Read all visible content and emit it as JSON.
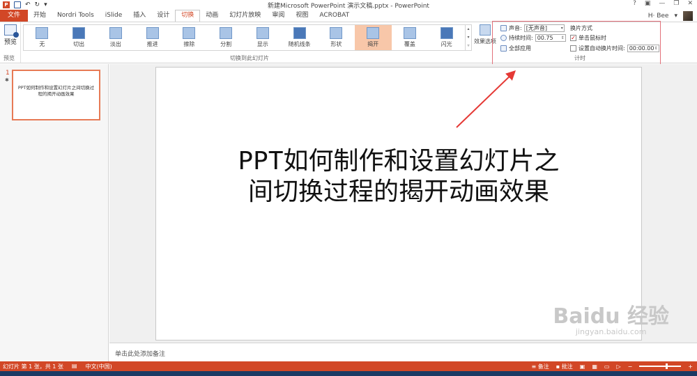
{
  "window": {
    "title": "新建Microsoft PowerPoint 演示文稿.pptx - PowerPoint",
    "controls": [
      "?",
      "▣",
      "—",
      "❐",
      "✕"
    ]
  },
  "tabs": [
    "文件",
    "开始",
    "Nordri Tools",
    "iSlide",
    "插入",
    "设计",
    "切换",
    "动画",
    "幻灯片放映",
    "审阅",
    "视图",
    "ACROBAT"
  ],
  "active_tab": "切换",
  "user": {
    "name": "H· Bee"
  },
  "ribbon": {
    "preview_label": "预览",
    "preview_group_label": "预览",
    "transition_group_label": "切换到此幻灯片",
    "effects": [
      {
        "label": "无",
        "icon": "none-transition-icon"
      },
      {
        "label": "切出",
        "icon": "cut-transition-icon"
      },
      {
        "label": "淡出",
        "icon": "fade-transition-icon"
      },
      {
        "label": "推进",
        "icon": "push-transition-icon"
      },
      {
        "label": "擦除",
        "icon": "wipe-transition-icon"
      },
      {
        "label": "分割",
        "icon": "split-transition-icon"
      },
      {
        "label": "显示",
        "icon": "reveal-transition-icon"
      },
      {
        "label": "随机线条",
        "icon": "random-bars-transition-icon"
      },
      {
        "label": "形状",
        "icon": "shape-transition-icon"
      },
      {
        "label": "揭开",
        "icon": "uncover-transition-icon"
      },
      {
        "label": "覆盖",
        "icon": "cover-transition-icon"
      },
      {
        "label": "闪光",
        "icon": "flash-transition-icon"
      }
    ],
    "selected_effect": "揭开",
    "effect_options_label": "效果选项",
    "timing": {
      "sound_label": "声音:",
      "sound_value": "[无声音]",
      "duration_label": "持续时间:",
      "duration_value": "00.75",
      "apply_all_label": "全部应用",
      "advance_label": "换片方式",
      "on_click_label": "单击鼠标时",
      "on_click_checked": true,
      "auto_label": "设置自动换片时间:",
      "auto_checked": false,
      "auto_value": "00:00.00",
      "group_label": "计时"
    }
  },
  "slides_pane": {
    "slide_number": "1",
    "star": "✱",
    "thumbnail_text": "PPT如何制作和设置幻灯片之间切换过程的揭开动画效果"
  },
  "slide": {
    "title_line1": "PPT如何制作和设置幻灯片之",
    "title_line2": "间切换过程的揭开动画效果"
  },
  "notes_placeholder": "单击此处添加备注",
  "watermark": {
    "main": "Baidu 经验",
    "sub": "jingyan.baidu.com"
  },
  "status": {
    "slide_info": "幻灯片 第 1 张，共 1 张",
    "language": "中文(中国)",
    "notes_label": "备注",
    "comments_label": "批注"
  },
  "colors": {
    "accent": "#d24726",
    "selected_effect_bg": "#f8c7a9",
    "highlight_box": "#e2707a",
    "arrow": "#e53935"
  }
}
